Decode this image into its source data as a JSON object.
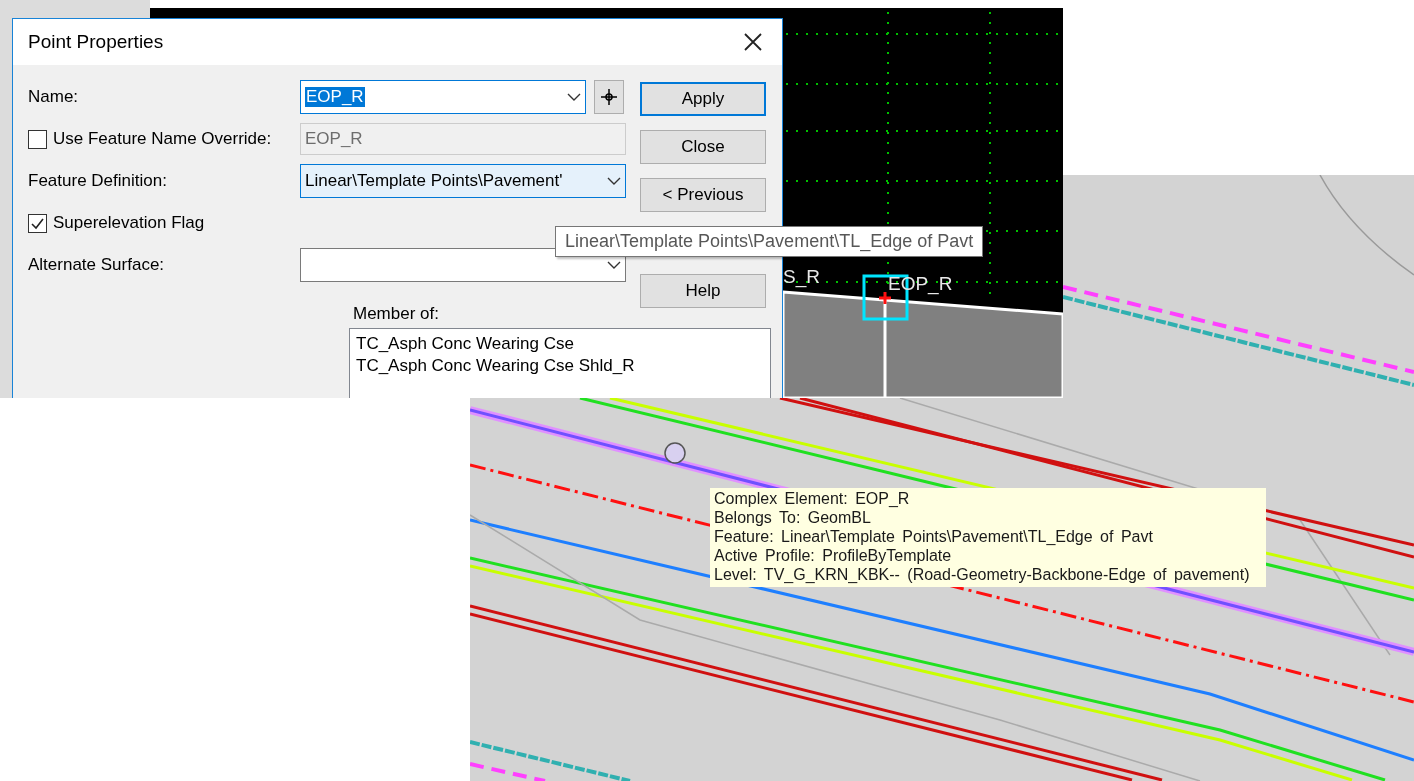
{
  "dialog": {
    "title": "Point Properties",
    "name": {
      "label": "Name:",
      "value": "EOP_R",
      "selected": true
    },
    "override": {
      "label": "Use Feature Name Override:",
      "checked": false,
      "value": "EOP_R",
      "disabled": true
    },
    "feature_definition": {
      "label": "Feature Definition:",
      "value": "Linear\\Template Points\\Pavement'"
    },
    "superelevation": {
      "label": "Superelevation Flag",
      "checked": true
    },
    "alternate_surface": {
      "label": "Alternate Surface:"
    },
    "buttons": [
      {
        "label": "Apply",
        "default": true
      },
      {
        "label": "Close",
        "default": false
      },
      {
        "label": "< Previous",
        "default": false
      },
      {
        "kind": "hidden"
      },
      {
        "label": "Help",
        "default": false
      }
    ],
    "member_of": {
      "label": "Member of:",
      "items": [
        "TC_Asph Conc Wearing Cse",
        "TC_Asph Conc Wearing Cse Shld_R"
      ]
    }
  },
  "tooltip": "Linear\\Template Points\\Pavement\\TL_Edge of Pavt",
  "cad_view": {
    "labels": [
      "S_R",
      "EOP_R"
    ]
  },
  "element_info": [
    "Complex Element: EOP_R",
    "Belongs To: GeomBL",
    "Feature: Linear\\Template Points\\Pavement\\TL_Edge of Pavt",
    "Active Profile: ProfileByTemplate",
    "Level: TV_G_KRN_KBK-- (Road-Geometry-Backbone-Edge of pavement)"
  ]
}
